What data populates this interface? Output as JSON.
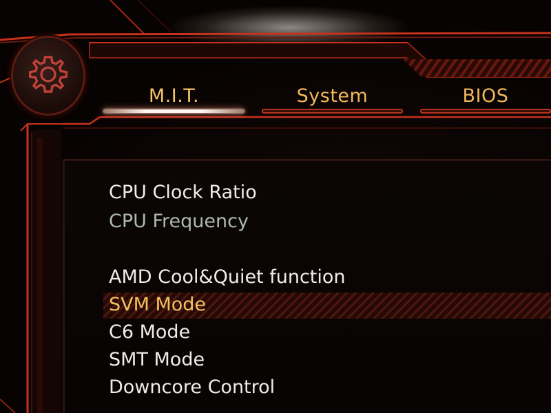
{
  "logo": {
    "icon": "gear-icon"
  },
  "tabs": [
    {
      "label": "M.I.T.",
      "active": true
    },
    {
      "label": "System",
      "active": false
    },
    {
      "label": "BIOS",
      "active": false
    }
  ],
  "menu": {
    "items": [
      {
        "label": "CPU Clock Ratio",
        "state": "normal"
      },
      {
        "label": "CPU Frequency",
        "state": "dim"
      },
      {
        "label": "AMD Cool&Quiet function",
        "state": "normal"
      },
      {
        "label": "SVM Mode",
        "state": "selected"
      },
      {
        "label": "C6 Mode",
        "state": "normal"
      },
      {
        "label": "SMT Mode",
        "state": "normal"
      },
      {
        "label": "Downcore Control",
        "state": "normal"
      }
    ]
  },
  "colors": {
    "accent_red": "#c8321c",
    "tab_text": "#f2b85a",
    "selected_text": "#f3c25e",
    "item_text": "#f1ecea",
    "dim_text": "#aeb8b6"
  }
}
